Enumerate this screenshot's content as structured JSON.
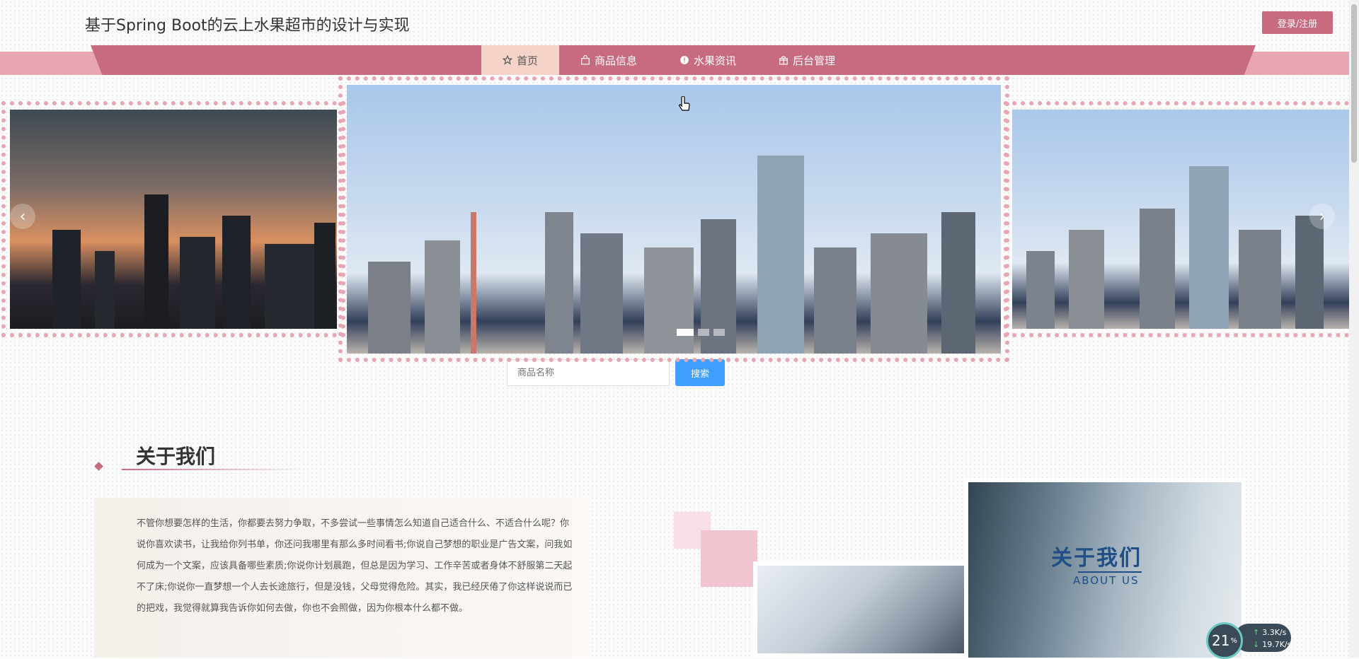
{
  "header": {
    "title": "基于Spring Boot的云上水果超市的设计与实现",
    "login_label": "登录/注册"
  },
  "nav": {
    "items": [
      {
        "label": "首页",
        "icon": "star-icon",
        "active": true
      },
      {
        "label": "商品信息",
        "icon": "shopping-bag-icon",
        "active": false
      },
      {
        "label": "水果资讯",
        "icon": "info-circle-icon",
        "active": false
      },
      {
        "label": "后台管理",
        "icon": "gift-box-icon",
        "active": false
      }
    ]
  },
  "carousel": {
    "prev_symbol": "‹",
    "next_symbol": "›",
    "active_index": 0,
    "slide_count": 3
  },
  "search": {
    "placeholder": "商品名称",
    "button_label": "搜索"
  },
  "about": {
    "title": "关于我们",
    "text": "不管你想要怎样的生活，你都要去努力争取，不多尝试一些事情怎么知道自己适合什么、不适合什么呢？你说你喜欢读书，让我给你列书单，你还问我哪里有那么多时间看书;你说自己梦想的职业是广告文案，问我如何成为一个文案，应该具备哪些素质;你说你计划晨跑，但总是因为学习、工作辛苦或者身体不舒服第二天起不了床;你说你一直梦想一个人去长途旅行，但是没钱，父母觉得危险。其实，我已经厌倦了你这样说说而已的把戏，我觉得就算我告诉你如何去做，你也不会照做，因为你根本什么都不做。",
    "image_title": "关于我们",
    "image_subtitle": "ABOUT US"
  },
  "net_widget": {
    "cpu_value": "21",
    "cpu_unit": "%",
    "upload": "3.3",
    "download": "19.7",
    "speed_unit": "K/s"
  },
  "colors": {
    "brand": "#c76b80",
    "nav_band": "#e8a5b4",
    "nav_active_bg": "#f6d3c9",
    "search_button": "#409eff"
  }
}
